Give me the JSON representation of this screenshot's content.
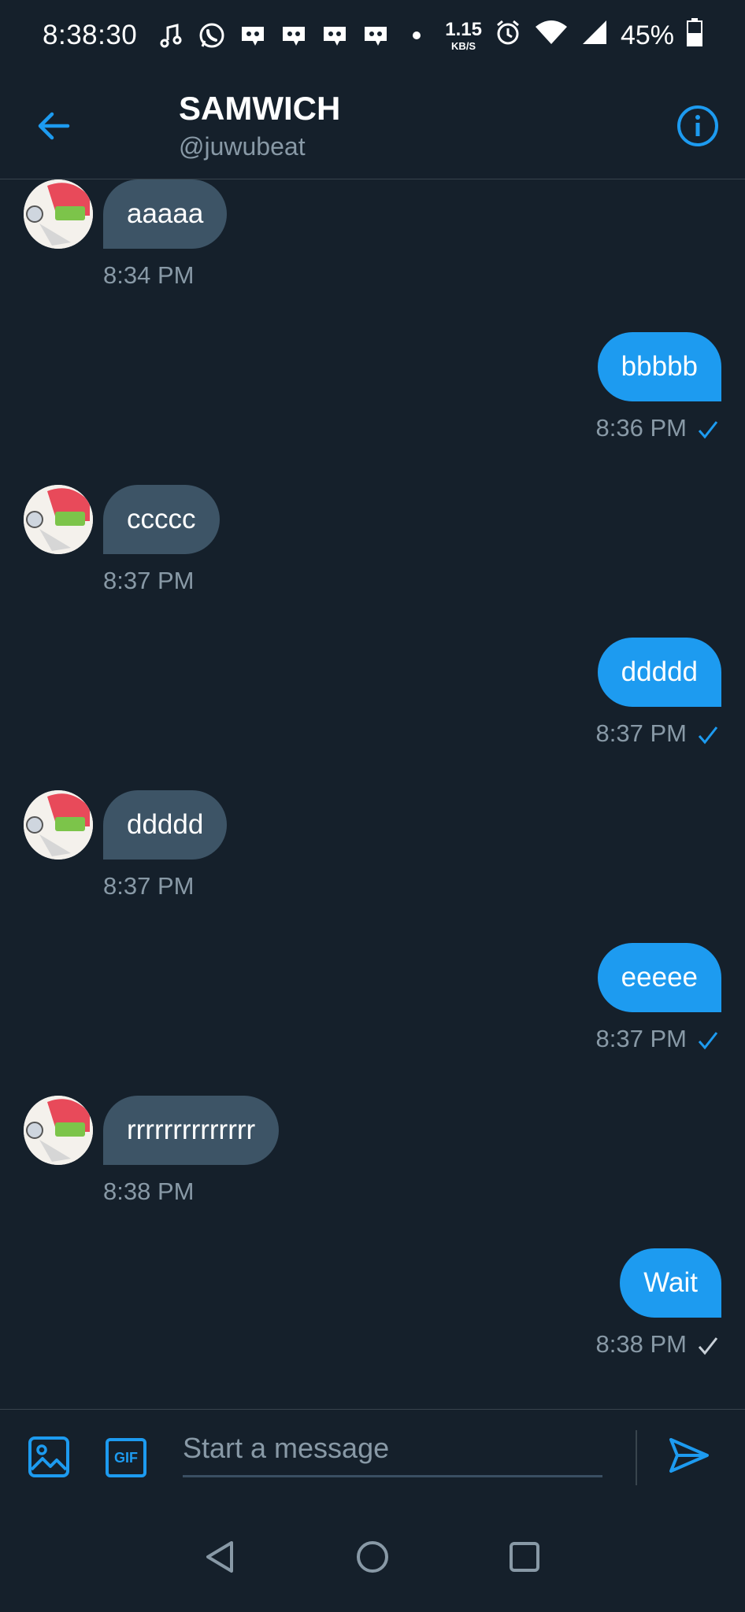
{
  "status_bar": {
    "time": "8:38:30",
    "net_speed_value": "1.15",
    "net_speed_unit": "KB/S",
    "battery": "45%",
    "icons": [
      "music-note-icon",
      "whatsapp-icon",
      "discord-icon",
      "discord-icon",
      "discord-icon",
      "discord-icon",
      "dot-icon",
      "alarm-icon",
      "wifi-icon",
      "signal-icon",
      "battery-icon"
    ]
  },
  "header": {
    "title": "SAMWICH",
    "handle": "@juwubeat",
    "back_icon": "arrow-left-icon",
    "info_icon": "info-icon"
  },
  "colors": {
    "background": "#15202b",
    "accent": "#1d9bf0",
    "incoming_bubble": "#3d5466",
    "muted_text": "#8899a6",
    "divider": "#38444d"
  },
  "messages": [
    {
      "direction": "in",
      "text": "aaaaa",
      "time": "8:34 PM"
    },
    {
      "direction": "out",
      "text": "bbbbb",
      "time": "8:36 PM",
      "status": "read"
    },
    {
      "direction": "in",
      "text": "ccccc",
      "time": "8:37 PM"
    },
    {
      "direction": "out",
      "text": "ddddd",
      "time": "8:37 PM",
      "status": "read"
    },
    {
      "direction": "in",
      "text": "ddddd",
      "time": "8:37 PM"
    },
    {
      "direction": "out",
      "text": "eeeee",
      "time": "8:37 PM",
      "status": "read"
    },
    {
      "direction": "in",
      "text": "rrrrrrrrrrrrrr",
      "time": "8:38 PM"
    },
    {
      "direction": "out",
      "text": "Wait",
      "time": "8:38 PM",
      "status": "sent"
    }
  ],
  "composer": {
    "placeholder": "Start a message",
    "gif_label": "GIF",
    "media_icon": "image-icon",
    "send_icon": "send-icon"
  },
  "navbar": {
    "icons": [
      "nav-back-icon",
      "nav-home-icon",
      "nav-recents-icon"
    ]
  }
}
